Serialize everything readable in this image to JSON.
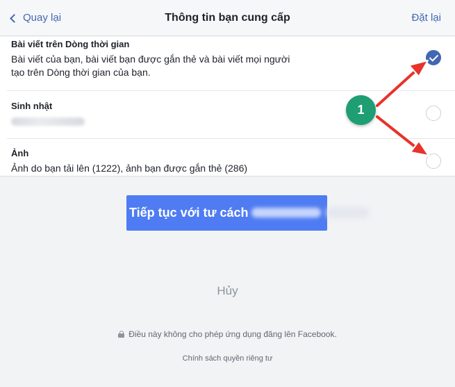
{
  "header": {
    "back_label": "Quay lại",
    "title": "Thông tin bạn cung cấp",
    "reset_label": "Đặt lại"
  },
  "items": [
    {
      "title": "Bài viết trên Dòng thời gian",
      "description": "Bài viết của bạn, bài viết bạn được gắn thẻ và bài viết mọi người tạo trên Dòng thời gian của bạn.",
      "selected": true
    },
    {
      "title": "Sinh nhật",
      "description": "",
      "selected": false
    },
    {
      "title": "Ảnh",
      "description": "Ảnh do bạn tải lên (1222), ảnh bạn được gắn thẻ (286)",
      "selected": false
    }
  ],
  "annotation": {
    "number": "1",
    "color": "#1e9e72",
    "arrow_color": "#e8332a"
  },
  "continue_button": {
    "label": "Tiếp tục với tư cách"
  },
  "cancel_label": "Hủy",
  "note": "Điều này không cho phép ứng dụng đăng lên Facebook.",
  "policy_link": "Chính sách quyền riêng tư",
  "colors": {
    "accent": "#4267b2",
    "button": "#4f7cf2"
  }
}
